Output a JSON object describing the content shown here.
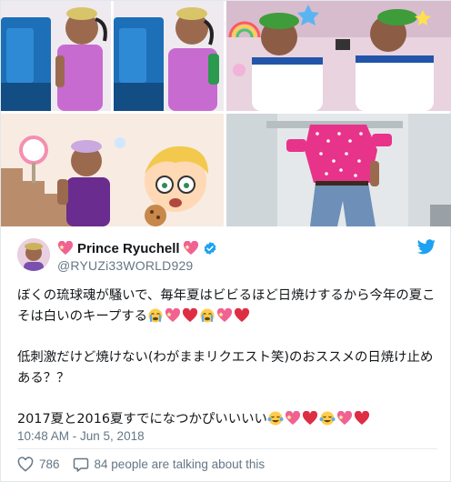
{
  "photos": {
    "items": [
      {
        "name": "photo-payphone-collage"
      },
      {
        "name": "photo-green-bandana-collage"
      },
      {
        "name": "photo-cartoon-cookie"
      },
      {
        "name": "photo-pink-polka-dot-shirt"
      }
    ]
  },
  "tweet": {
    "author": {
      "display_name": "Prince Ryuchell",
      "handle": "@RYUZi33WORLD929",
      "verified": true
    },
    "body": {
      "line1_text": "ぼくの琉球魂が騒いで、毎年夏はビビるほど日焼けするから今年の夏こそは白いのキープする",
      "line1_emoji": [
        "face-with-tears-icon",
        "sparkling-heart-icon",
        "red-heart-icon",
        "face-with-tears-icon",
        "sparkling-heart-icon",
        "red-heart-icon"
      ],
      "line2_text": "低刺激だけど焼けない(わがままリクエスト笑)のおススメの日焼け止めある？？",
      "line3_text": "2017夏と2016夏すでになつかぴいいいい",
      "line3_emoji": [
        "tears-of-joy-icon",
        "sparkling-heart-icon",
        "red-heart-icon",
        "tears-of-joy-icon",
        "sparkling-heart-icon",
        "red-heart-icon"
      ]
    },
    "timestamp": "10:48 AM - Jun 5, 2018",
    "likes": "786",
    "talking": "84 people are talking about this"
  },
  "colors": {
    "brand_blue": "#1da1f2",
    "heart_red": "#e0245e",
    "sparkle_pink": "#f06292",
    "secondary_text": "#657786"
  }
}
